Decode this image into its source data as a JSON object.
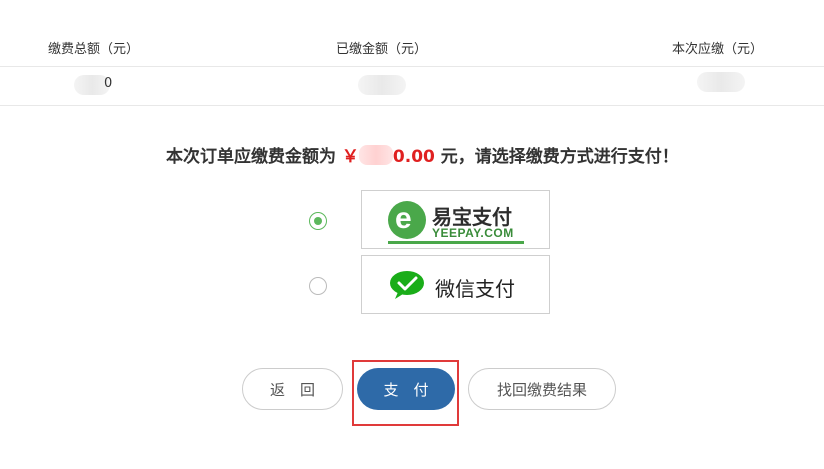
{
  "summary": {
    "headers": [
      "缴费总额（元）",
      "已缴金额（元）",
      "本次应缴（元）"
    ],
    "total_tail": "0"
  },
  "prompt": {
    "before": "本次订单应缴费金额为",
    "currency": "￥",
    "amount_visible": "0.00",
    "after": "元，请选择缴费方式进行支付！"
  },
  "payment_methods": [
    {
      "name": "易宝支付",
      "sub": "YEEPAY.COM",
      "selected": true,
      "icon": "yeepay-logo-icon",
      "color": "#4aa84a"
    },
    {
      "name": "微信支付",
      "selected": false,
      "icon": "wechat-pay-icon",
      "color": "#1aad19"
    }
  ],
  "buttons": {
    "back": "返　回",
    "pay": "支　付",
    "find": "找回缴费结果"
  },
  "colors": {
    "accent": "#2e6aa8",
    "amount": "#e02020",
    "highlight": "#e03a3a"
  }
}
